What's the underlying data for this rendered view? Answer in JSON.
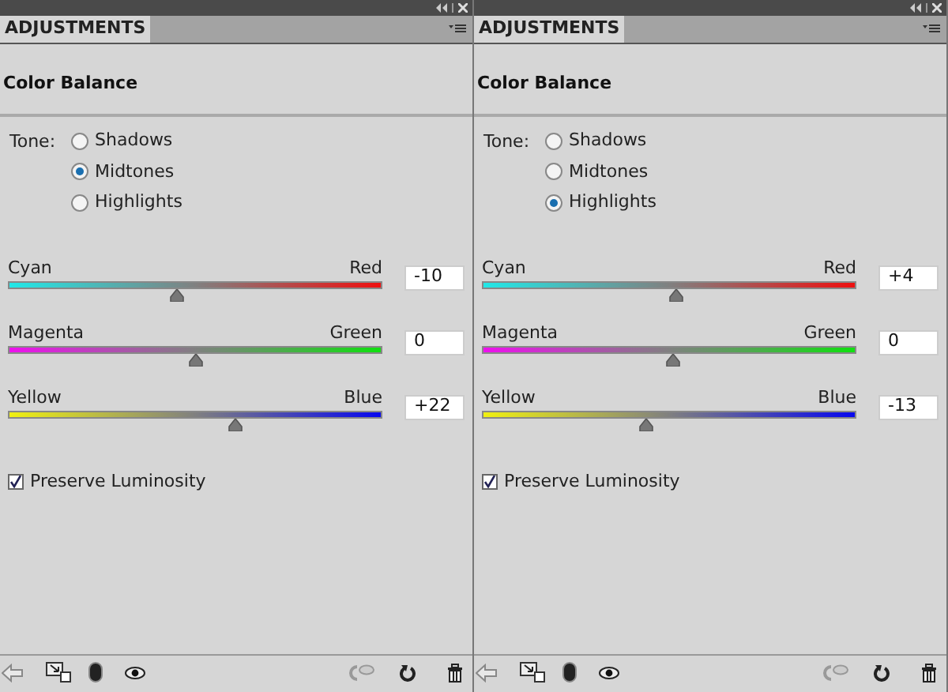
{
  "panels": [
    {
      "tab": {
        "label": "ADJUSTMENTS",
        "selected": true
      },
      "title": "Color Balance",
      "tone_label": "Tone:",
      "tones": [
        {
          "label": "Shadows",
          "selected": false
        },
        {
          "label": "Midtones",
          "selected": true
        },
        {
          "label": "Highlights",
          "selected": false
        }
      ],
      "sliders": [
        {
          "left": "Cyan",
          "right": "Red",
          "level": 0.45,
          "value": "-10"
        },
        {
          "left": "Magenta",
          "right": "Green",
          "level": 0.5,
          "value": "0"
        },
        {
          "left": "Yellow",
          "right": "Blue",
          "level": 0.61,
          "value": "+22"
        }
      ],
      "preserve_luminosity": {
        "label": "Preserve Luminosity",
        "checked": true
      }
    },
    {
      "tab": {
        "label": "ADJUSTMENTS",
        "selected": true
      },
      "title": "Color Balance",
      "tone_label": "Tone:",
      "tones": [
        {
          "label": "Shadows",
          "selected": false
        },
        {
          "label": "Midtones",
          "selected": false
        },
        {
          "label": "Highlights",
          "selected": true
        }
      ],
      "sliders": [
        {
          "left": "Cyan",
          "right": "Red",
          "level": 0.52,
          "value": "+4"
        },
        {
          "left": "Magenta",
          "right": "Green",
          "level": 0.51,
          "value": "0"
        },
        {
          "left": "Yellow",
          "right": "Blue",
          "level": 0.44,
          "value": "-13"
        }
      ],
      "preserve_luminosity": {
        "label": "Preserve Luminosity",
        "checked": true
      }
    }
  ]
}
